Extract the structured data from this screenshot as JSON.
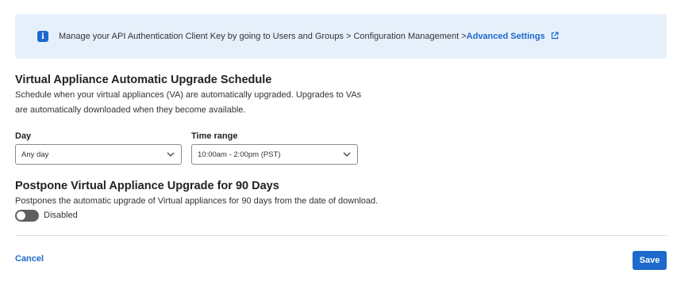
{
  "banner": {
    "icon": "info-icon",
    "text": "Manage your API Authentication Client Key by going to Users and Groups > Configuration Management >",
    "link_label": "Advanced Settings",
    "link_icon": "external-link-icon"
  },
  "schedule": {
    "title": "Virtual Appliance Automatic Upgrade Schedule",
    "description_line1": "Schedule when your virtual appliances (VA) are automatically upgraded. Upgrades to VAs",
    "description_line2": "are automatically downloaded when they become available.",
    "day": {
      "label": "Day",
      "value": "Any day"
    },
    "time_range": {
      "label": "Time range",
      "value": "10:00am - 2:00pm (PST)"
    }
  },
  "postpone": {
    "title": "Postpone Virtual Appliance Upgrade for 90 Days",
    "description": "Postpones the automatic upgrade of Virtual appliances for 90 days from the date of download.",
    "toggle_state": "off",
    "toggle_label": "Disabled"
  },
  "footer": {
    "cancel_label": "Cancel",
    "save_label": "Save"
  },
  "colors": {
    "accent": "#1d69cc",
    "banner_bg": "#e6f0fb",
    "toggle_off": "#5f5f5f"
  }
}
